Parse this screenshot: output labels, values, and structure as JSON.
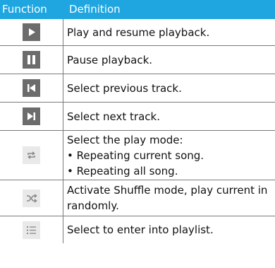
{
  "header": {
    "function_label": "Function",
    "definition_label": "Definition"
  },
  "rows": [
    {
      "icon": "play-icon",
      "lines": [
        "Play and resume playback."
      ]
    },
    {
      "icon": "pause-icon",
      "lines": [
        "Pause playback."
      ]
    },
    {
      "icon": "previous-track-icon",
      "lines": [
        "Select previous track."
      ]
    },
    {
      "icon": "next-track-icon",
      "lines": [
        "Select next track."
      ]
    },
    {
      "icon": "repeat-icon",
      "lines": [
        "Select the play mode:",
        "• Repeating current song.",
        "• Repeating all song."
      ]
    },
    {
      "icon": "shuffle-icon",
      "lines": [
        "Activate Shuffle mode, play current in",
        "randomly."
      ]
    },
    {
      "icon": "playlist-icon",
      "lines": [
        "Select to enter into playlist."
      ]
    }
  ],
  "colors": {
    "header_background": "#1fa6e0",
    "header_text": "#ffffff",
    "dark_icon_background": "#6c6c6c",
    "light_icon_background": "#e9e9e9",
    "rule": "#7a7a7a"
  }
}
